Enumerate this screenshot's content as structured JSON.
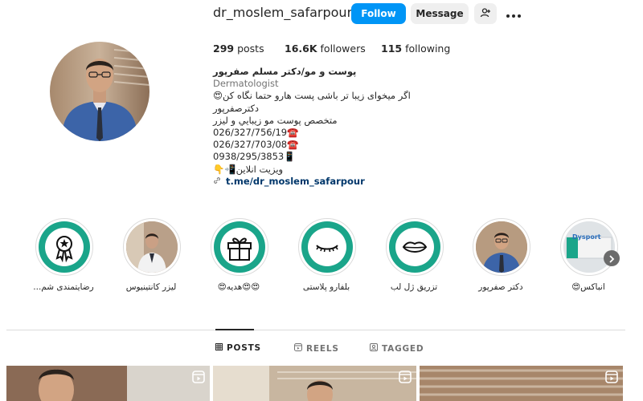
{
  "profile": {
    "username": "dr_moslem_safarpour",
    "follow_label": "Follow",
    "message_label": "Message"
  },
  "stats": {
    "posts_count": "299",
    "posts_label": "posts",
    "followers_count": "16.6K",
    "followers_label": "followers",
    "following_count": "115",
    "following_label": "following"
  },
  "bio": {
    "name": "پوست و مو/دکتر مسلم صفرپور",
    "category": "Dermatologist",
    "lines": [
      "اگر میخوای زیبا تر باشی پست هارو حتما نگاه کن😍",
      "دکترصفرپور",
      "متخصص پوست مو زيبايي و ليزر",
      "026/327/756/19☎️",
      "026/327/703/08☎️",
      "0938/295/3853📱",
      "ویزیت انلاین📲👇"
    ],
    "link": "t.me/dr_moslem_safarpour"
  },
  "highlights": [
    {
      "label": "رضایتمندی شم..."
    },
    {
      "label": "لیزر کانتینیوس"
    },
    {
      "label": "😍😍هدیه😍"
    },
    {
      "label": "بلفارو پلاستی"
    },
    {
      "label": "تزریق ژل لب"
    },
    {
      "label": "دکتر صفرپور"
    },
    {
      "label": "انباکس😍"
    }
  ],
  "highlight_thumb_text": {
    "dysport": "Dysport"
  },
  "tabs": [
    {
      "label": "POSTS",
      "active": true
    },
    {
      "label": "REELS",
      "active": false
    },
    {
      "label": "TAGGED",
      "active": false
    }
  ],
  "colors": {
    "accent": "#0095f6",
    "teal": "#1aa58a",
    "link": "#00376b"
  }
}
